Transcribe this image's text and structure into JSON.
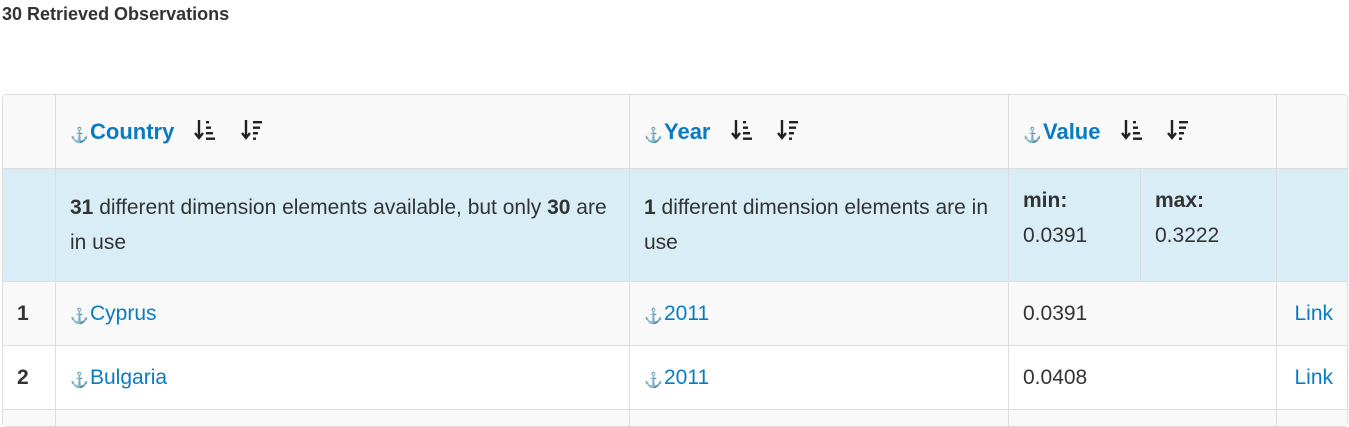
{
  "title": "30 Retrieved Observations",
  "columns": [
    {
      "label": "Country"
    },
    {
      "label": "Year"
    },
    {
      "label": "Value"
    }
  ],
  "summary": {
    "country_count": "31",
    "country_text_a": "different dimension elements available, but only",
    "country_inuse": "30",
    "country_text_b": "are in use",
    "year_count": "1",
    "year_text": "different dimension elements are in use",
    "min_label": "min:",
    "min_value": "0.0391",
    "max_label": "max:",
    "max_value": "0.3222"
  },
  "rows": [
    {
      "num": "1",
      "country": "Cyprus",
      "year": "2011",
      "value": "0.0391",
      "link": "Link"
    },
    {
      "num": "2",
      "country": "Bulgaria",
      "year": "2011",
      "value": "0.0408",
      "link": "Link"
    }
  ],
  "colors": {
    "link": "#0a7bc2",
    "summary_bg": "#d9edf7",
    "header_bg": "#f9f9f9",
    "border": "#dddddd"
  },
  "icons": [
    "anchor-icon",
    "sort-ascending-icon",
    "sort-descending-icon"
  ]
}
